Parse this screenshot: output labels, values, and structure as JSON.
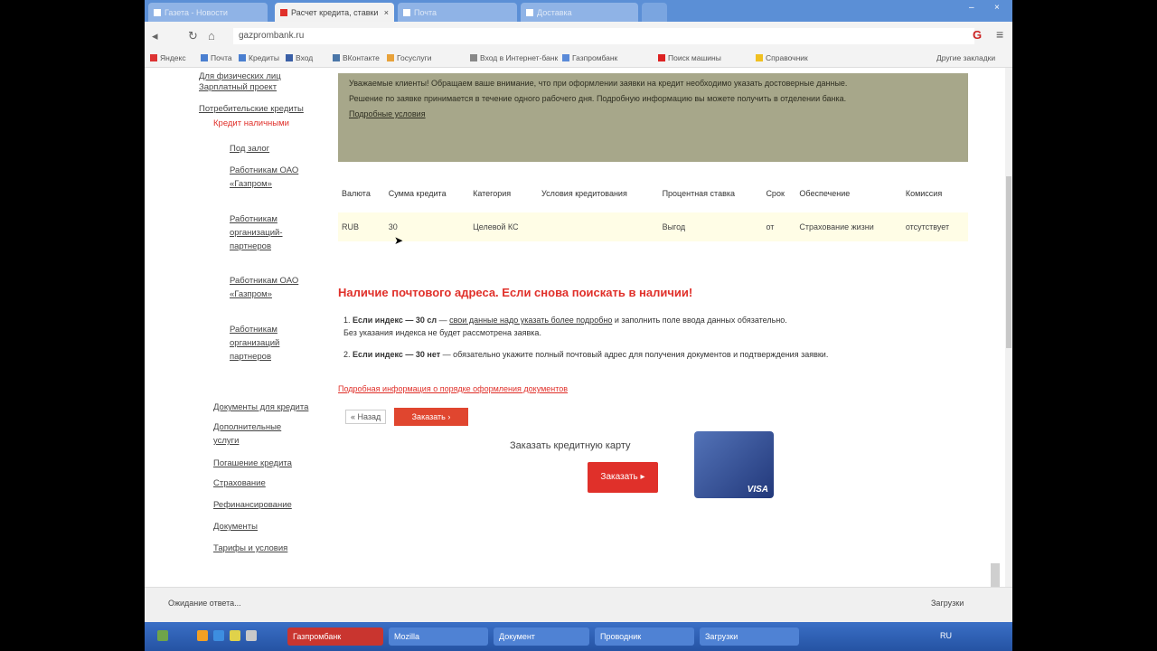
{
  "browser": {
    "tabs": [
      {
        "label": "Газета - Новости",
        "active": false
      },
      {
        "label": "Расчет кредита, ставки",
        "active": true
      },
      {
        "label": "Почта",
        "active": false
      },
      {
        "label": "Доставка",
        "active": false
      }
    ],
    "url": "gazprombank.ru",
    "bookmarks": [
      "Яндекс",
      "Почта",
      "Кредиты",
      "Вход",
      "ВКонтакте",
      "Госуслуги",
      "Вход в Интернет-банк",
      "Газпромбанк",
      "Поиск машины",
      "Справочник",
      "Другие закладки"
    ]
  },
  "sidebar": {
    "items": [
      {
        "label": "Для физических лиц",
        "red": false
      },
      {
        "label": "Зарплатный проект",
        "red": false
      },
      {
        "label": "Потребительские кредиты",
        "red": false
      },
      {
        "label": "Кредит наличными",
        "red": true
      },
      {
        "label": "Под залог",
        "red": false
      },
      {
        "label": "Работникам ОАО «Газпром»",
        "red": false
      },
      {
        "label": "Работникам организаций-партнеров",
        "red": false
      },
      {
        "label": "Работникам ОАО «Газпром»",
        "red": false
      },
      {
        "label": "Работникам организаций партнеров",
        "red": false
      },
      {
        "label": "Документы для кредита",
        "red": false
      },
      {
        "label": "Дополнительные услуги",
        "red": false
      },
      {
        "label": "Погашение кредита",
        "red": false
      },
      {
        "label": "Страхование",
        "red": false
      },
      {
        "label": "Рефинансирование",
        "red": false
      },
      {
        "label": "Документы",
        "red": false
      },
      {
        "label": "Тарифы и условия",
        "red": false
      }
    ]
  },
  "notice": {
    "line1": "Уважаемые клиенты! Обращаем ваше внимание, что при оформлении заявки на кредит необходимо указать достоверные данные.",
    "line2": "Решение по заявке принимается в течение одного рабочего дня. Подробную информацию вы можете получить в отделении банка.",
    "link": "Подробные условия"
  },
  "table": {
    "headers": [
      "Валюта",
      "Сумма кредита",
      "Категория",
      "Условия кредитования",
      "Процентная ставка",
      "Срок",
      "Обеспечение",
      "Комиссия"
    ],
    "rows": [
      [
        "RUB",
        "30",
        "Целевой КС",
        "",
        "Выгод",
        "от",
        "Страхование жизни",
        "отсутствует"
      ]
    ]
  },
  "warning": {
    "title": "Наличие почтового адреса. Если снова поискать в наличии!",
    "p1_num": "1.",
    "p1_bold": "Если индекс — 30 сл",
    "p1_link": "свои данные надо указать более подробно",
    "p1_rest": "и заполнить поле ввода данных обязательно.",
    "p1_line2": "Без указания индекса не будет рассмотрена заявка.",
    "p2_num": "2.",
    "p2_bold": "Если индекс — 30 нет",
    "p2_rest": "обязательно укажите полный почтовый адрес для получения документов и подтверждения заявки.",
    "redline": "Подробная информация о порядке оформления документов"
  },
  "actions": {
    "back": "« Назад",
    "order": "Заказать ›",
    "card_promo": "Заказать кредитную карту",
    "card_button": "Заказать ▸",
    "card_brand": "VISA"
  },
  "status": {
    "text": "Ожидание ответа...",
    "downloads": "Загрузки"
  },
  "taskbar": {
    "tasks": [
      {
        "label": "Газпромбанк",
        "active": true
      },
      {
        "label": "Mozilla",
        "active": false
      },
      {
        "label": "Документ",
        "active": false
      },
      {
        "label": "Проводник",
        "active": false
      },
      {
        "label": "Загрузки",
        "active": false
      }
    ],
    "clock": "RU"
  },
  "colors": {
    "accent_red": "#e0302a",
    "notice_bg": "#a7a78a",
    "taskbar": "#2553a3"
  }
}
